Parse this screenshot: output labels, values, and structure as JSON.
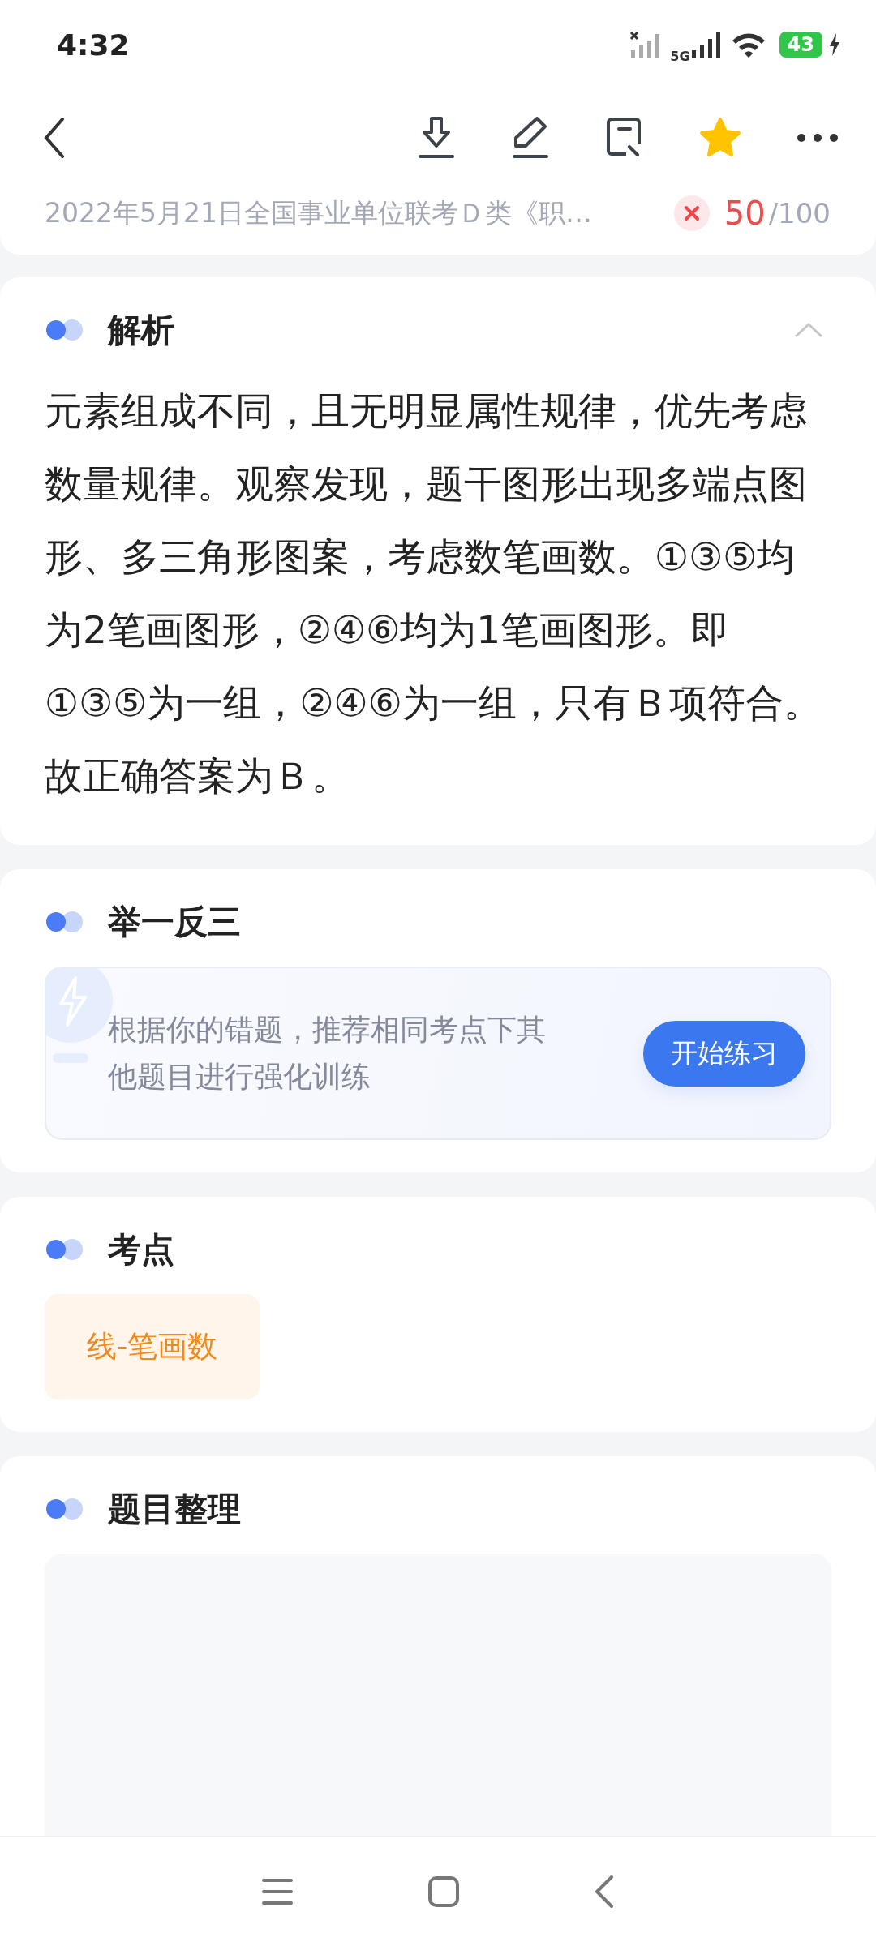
{
  "status_bar": {
    "time": "4:32",
    "network": "5G",
    "battery": "43"
  },
  "toolbar": {
    "favorited": true
  },
  "exam": {
    "title": "2022年5月21日全国事业单位联考Ｄ类《职…",
    "correct": false,
    "score": "50",
    "total": "/100"
  },
  "analysis": {
    "title": "解析",
    "expanded": true,
    "paragraphs": [
      "元素组成不同，且无明显属性规律，优先考虑数量规律。观察发现，题干图形出现多端点图形、多三角形图案，考虑数笔画数。①③⑤均为2笔画图形，②④⑥均为1笔画图形。即①③⑤为一组，②④⑥为一组，只有Ｂ项符合。",
      "故正确答案为Ｂ。"
    ]
  },
  "practice": {
    "title": "举一反三",
    "text": "根据你的错题，推荐相同考点下其他题目进行强化训练",
    "button": "开始练习"
  },
  "points": {
    "title": "考点",
    "tags": [
      "线-笔画数"
    ]
  },
  "organize": {
    "title": "题目整理"
  }
}
